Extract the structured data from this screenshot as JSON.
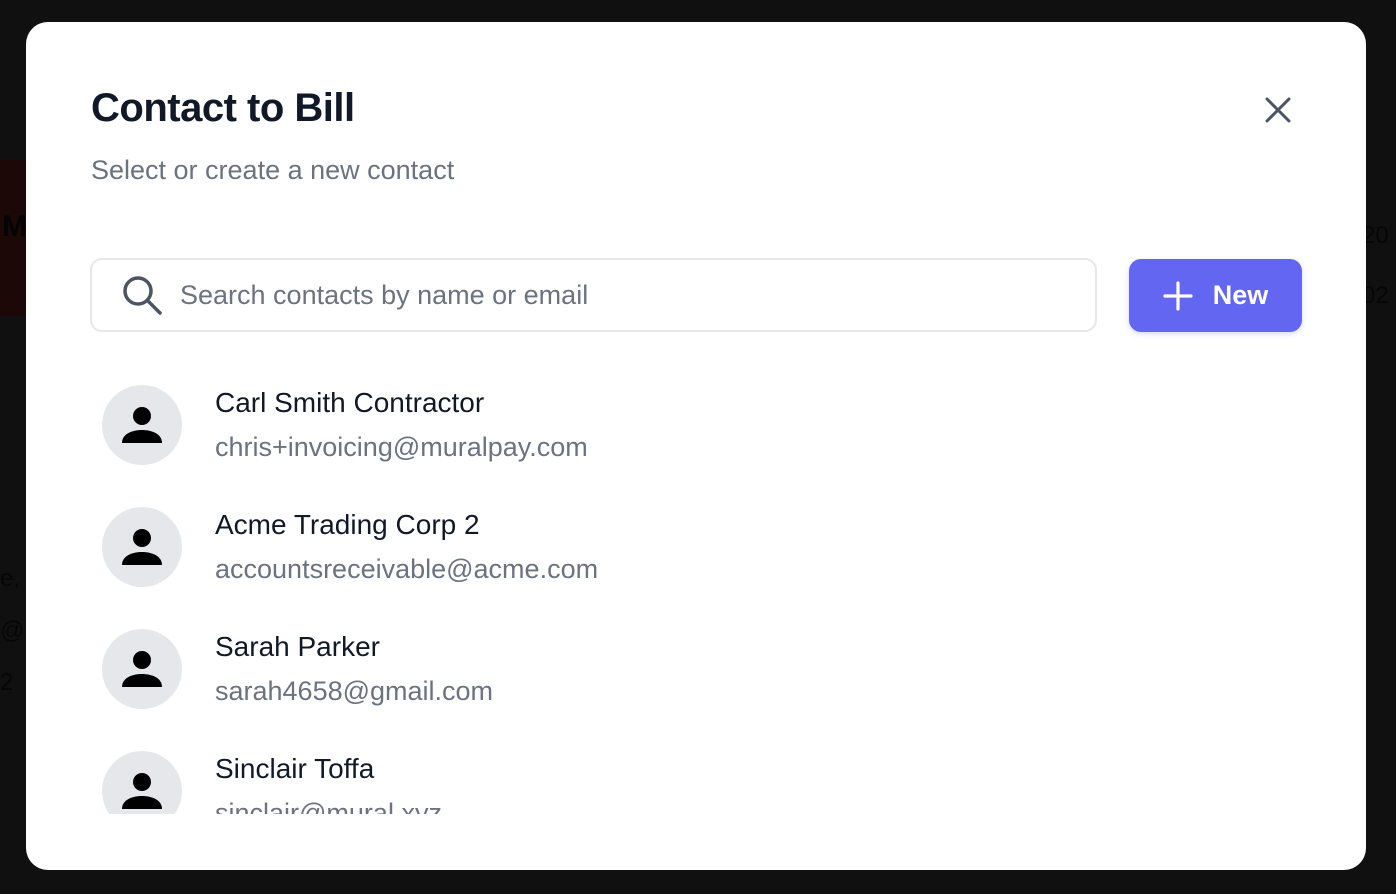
{
  "modal": {
    "title": "Contact to Bill",
    "subtitle": "Select or create a new contact",
    "close_icon": "close-icon"
  },
  "search": {
    "placeholder": "Search contacts by name or email",
    "value": "",
    "icon": "search-icon"
  },
  "new_button": {
    "label": "New",
    "icon": "plus-icon"
  },
  "contacts": [
    {
      "name": "Carl Smith Contractor",
      "email": "chris+invoicing@muralpay.com",
      "icon": "person-icon"
    },
    {
      "name": "Acme Trading Corp 2",
      "email": "accountsreceivable@acme.com",
      "icon": "person-icon"
    },
    {
      "name": "Sarah Parker",
      "email": "sarah4658@gmail.com",
      "icon": "person-icon"
    },
    {
      "name": "Sinclair Toffa",
      "email": "sinclair@mural.xyz",
      "icon": "person-icon"
    }
  ],
  "background": {
    "logo_text": "M",
    "right_texts": [
      "20",
      "02"
    ],
    "left_texts": [
      "e,",
      "@r",
      "2"
    ]
  },
  "colors": {
    "accent": "#6366f1",
    "title": "#111827",
    "muted": "#6b7280",
    "avatar_bg": "#e5e7eb"
  }
}
